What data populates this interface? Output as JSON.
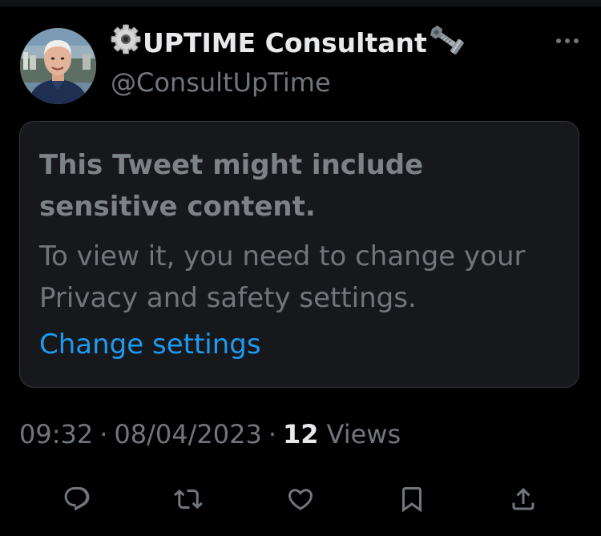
{
  "tweet": {
    "author": {
      "name_prefix_emoji": "⚙️",
      "name": "UPTIME Consultant",
      "name_suffix_emoji": "🔩",
      "handle": "@ConsultUpTime"
    },
    "notice": {
      "title": "This Tweet might include sensitive content.",
      "body": "To view it, you need to change your Privacy and safety settings.",
      "link": "Change settings"
    },
    "meta": {
      "time": "09:32",
      "separator": "·",
      "date": "08/04/2023",
      "views_count": "12",
      "views_label": "Views"
    },
    "actions": [
      {
        "name": "reply",
        "icon": "reply-icon"
      },
      {
        "name": "retweet",
        "icon": "retweet-icon"
      },
      {
        "name": "like",
        "icon": "heart-icon"
      },
      {
        "name": "bookmark",
        "icon": "bookmark-icon"
      },
      {
        "name": "share",
        "icon": "share-icon"
      }
    ]
  },
  "colors": {
    "background": "#000000",
    "card": "#16181c",
    "border": "#33373b",
    "text_primary": "#e7e9ea",
    "text_secondary": "#71767b",
    "link": "#1d9bf0"
  }
}
